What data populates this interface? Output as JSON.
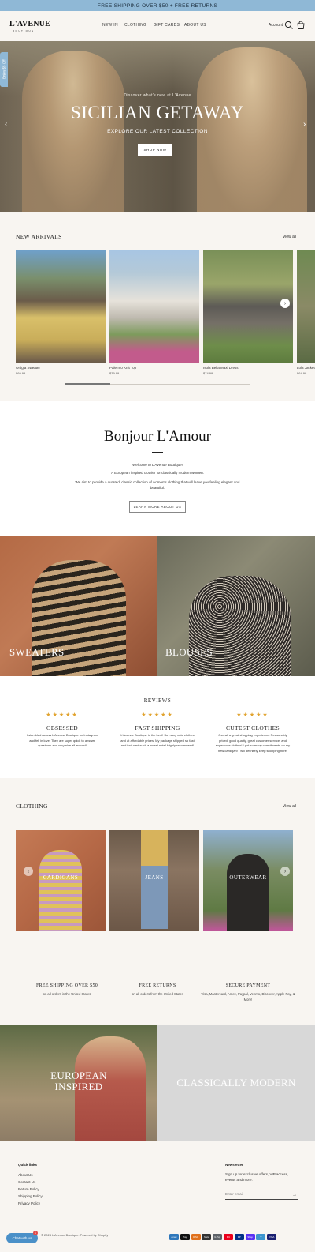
{
  "announcement": "FREE SHIPPING OVER $50 + FREE RETURNS",
  "header": {
    "logo": "L'AVENUE",
    "logo_sub": "BOUTIQUE",
    "nav": [
      "NEW IN",
      "CLOTHING",
      "GIFT CARDS",
      "ABOUT US"
    ],
    "account": "Account",
    "icons": [
      "search-icon",
      "cart-icon"
    ]
  },
  "side_tab": "Enjoy $5 Off",
  "hero": {
    "kicker": "Discover what's new at L'Avenue",
    "title": "SICILIAN GETAWAY",
    "subtitle": "EXPLORE OUR LATEST COLLECTION",
    "button": "SHOP NOW"
  },
  "new_arrivals": {
    "title": "NEW ARRIVALS",
    "view_all": "View all",
    "products": [
      {
        "name": "Ortigia Sweater",
        "price": "$69.99"
      },
      {
        "name": "Palermo Knit Top",
        "price": "$39.99"
      },
      {
        "name": "Isola Bella Maxi Dress",
        "price": "$74.99"
      },
      {
        "name": "Lola Jacket",
        "price": "$64.99"
      }
    ]
  },
  "bonjour": {
    "title": "Bonjour L'Amour",
    "p1": "Welcome to L'Avenue Boutique!",
    "p2": "A European inspired clothier for classically modern women.",
    "p3a": "We aim to provide a curated, classic collection of women's clothing that will leave you feeling elegant and",
    "p3b": "beautiful.",
    "button": "LEARN MORE ABOUT US"
  },
  "categories": [
    "SWEATERS",
    "BLOUSES"
  ],
  "reviews": {
    "title": "REVIEWS",
    "items": [
      {
        "stars": "★★★★★",
        "heading": "OBSESSED",
        "body": "I stumbled across L'Avenue Boutique on Instagram and fell in love! They are super quick to answer questions and very nice all around!"
      },
      {
        "stars": "★★★★★",
        "heading": "FAST SHIPPING",
        "body": "L'Avenue Boutique is the best! So many cute clothes and at affordable prices. My package shipped so fast and included such a sweet note! Highly recommend!"
      },
      {
        "stars": "★★★★★",
        "heading": "CUTEST CLOTHES",
        "body": "Overall a great shopping experience. Reasonably priced, good quality, great customer service, and super cute clothes! I got so many compliments on my new cardigan! I will definitely keep shopping here!"
      }
    ]
  },
  "clothing": {
    "title": "CLOTHING",
    "view_all": "View all",
    "items": [
      "CARDIGANS",
      "JEANS",
      "OUTERWEAR"
    ]
  },
  "features": [
    {
      "title": "FREE SHIPPING OVER $50",
      "body": "on all orders in the United States"
    },
    {
      "title": "FREE RETURNS",
      "body": "on all orders from the United States"
    },
    {
      "title": "SECURE PAYMENT",
      "body": "Visa, Mastercard, Amex, Paypal, Venmo, Discover, Apple Pay, & More!"
    }
  ],
  "promo": {
    "left": [
      "EUROPEAN",
      "INSPIRED"
    ],
    "right": "CLASSICALLY MODERN"
  },
  "footer": {
    "quick_links_title": "Quick links",
    "links": [
      "About Us",
      "Contact Us",
      "Return Policy",
      "Shipping Policy",
      "Privacy Policy"
    ],
    "newsletter_title": "Newsletter",
    "newsletter_text": "Sign up for exclusive offers, VIP access, events and more.",
    "email_placeholder": "Enter email",
    "copyright": "© 2024 L'Avenue Boutique. Powered by Shopify",
    "chat": "Chat with us",
    "chat_badge": "1",
    "payments": [
      {
        "name": "Amex",
        "color": "#2e77bb"
      },
      {
        "name": "Pay",
        "color": "#111111"
      },
      {
        "name": "DISC",
        "color": "#e0701b"
      },
      {
        "name": "Meta",
        "color": "#333333"
      },
      {
        "name": "G Pay",
        "color": "#5f6368"
      },
      {
        "name": "MC",
        "color": "#eb001b"
      },
      {
        "name": "PP",
        "color": "#003087"
      },
      {
        "name": "Shop",
        "color": "#5a31f4"
      },
      {
        "name": "V",
        "color": "#3d95ce"
      },
      {
        "name": "VISA",
        "color": "#1a1f71"
      }
    ]
  },
  "colors": {
    "accent": "#8fb8d6",
    "star": "#e1a32e",
    "cream": "#f8f5f1"
  }
}
